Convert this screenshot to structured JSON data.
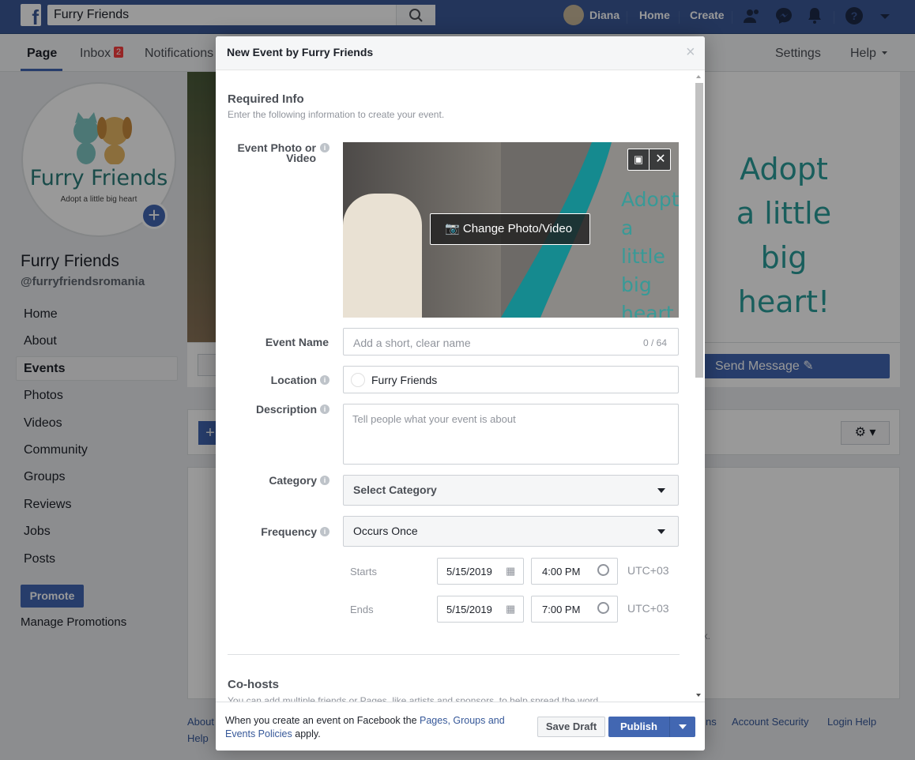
{
  "topbar": {
    "search_value": "Furry Friends",
    "user": "Diana",
    "home": "Home",
    "create": "Create"
  },
  "pagenav": {
    "items": [
      "Page",
      "Inbox",
      "Notifications"
    ],
    "inbox_badge": "2",
    "settings": "Settings",
    "help": "Help"
  },
  "page": {
    "name": "Furry Friends",
    "handle": "@furryfriendsromania",
    "logo_title": "Furry Friends",
    "logo_tagline": "Adopt a little big heart",
    "cover_text": [
      "Adopt",
      "a little",
      "big heart!"
    ],
    "send_message": "Send Message"
  },
  "sidebar": {
    "items": [
      "Home",
      "About",
      "Events",
      "Photos",
      "Videos",
      "Community",
      "Groups",
      "Reviews",
      "Jobs",
      "Posts"
    ],
    "promote": "Promote",
    "manage_promotions": "Manage Promotions"
  },
  "footer": {
    "left": [
      "About",
      "Help"
    ],
    "right": [
      "ns",
      "Account Security",
      "Login Help"
    ],
    "ok_fragment": "ok."
  },
  "modal": {
    "title": "New Event by Furry Friends",
    "close": "×",
    "section_title": "Required Info",
    "section_sub": "Enter the following information to create your event.",
    "photo_label": "Event Photo or Video",
    "change_photo": "Change Photo/Video",
    "photo_text": [
      "Adopt",
      "a little",
      "big heart"
    ],
    "event_name_label": "Event Name",
    "event_name_placeholder": "Add a short, clear name",
    "event_name_count": "0 / 64",
    "location_label": "Location",
    "location_value": "Furry Friends",
    "description_label": "Description",
    "description_placeholder": "Tell people what your event is about",
    "category_label": "Category",
    "category_value": "Select Category",
    "frequency_label": "Frequency",
    "frequency_value": "Occurs Once",
    "starts_label": "Starts",
    "starts_date": "5/15/2019",
    "starts_time": "4:00 PM",
    "ends_label": "Ends",
    "ends_date": "5/15/2019",
    "ends_time": "7:00 PM",
    "timezone": "UTC+03",
    "cohosts_title": "Co-hosts",
    "cohosts_sub": "You can add multiple friends or Pages, like artists and sponsors, to help spread the word.",
    "footer_text_1": "When you create an event on Facebook the ",
    "footer_link": "Pages, Groups and Events Policies",
    "footer_text_2": " apply.",
    "save_draft": "Save Draft",
    "publish": "Publish"
  },
  "colors": {
    "brand": "#3b5998",
    "accent": "#4267b2",
    "teal": "#2a9d9a"
  }
}
